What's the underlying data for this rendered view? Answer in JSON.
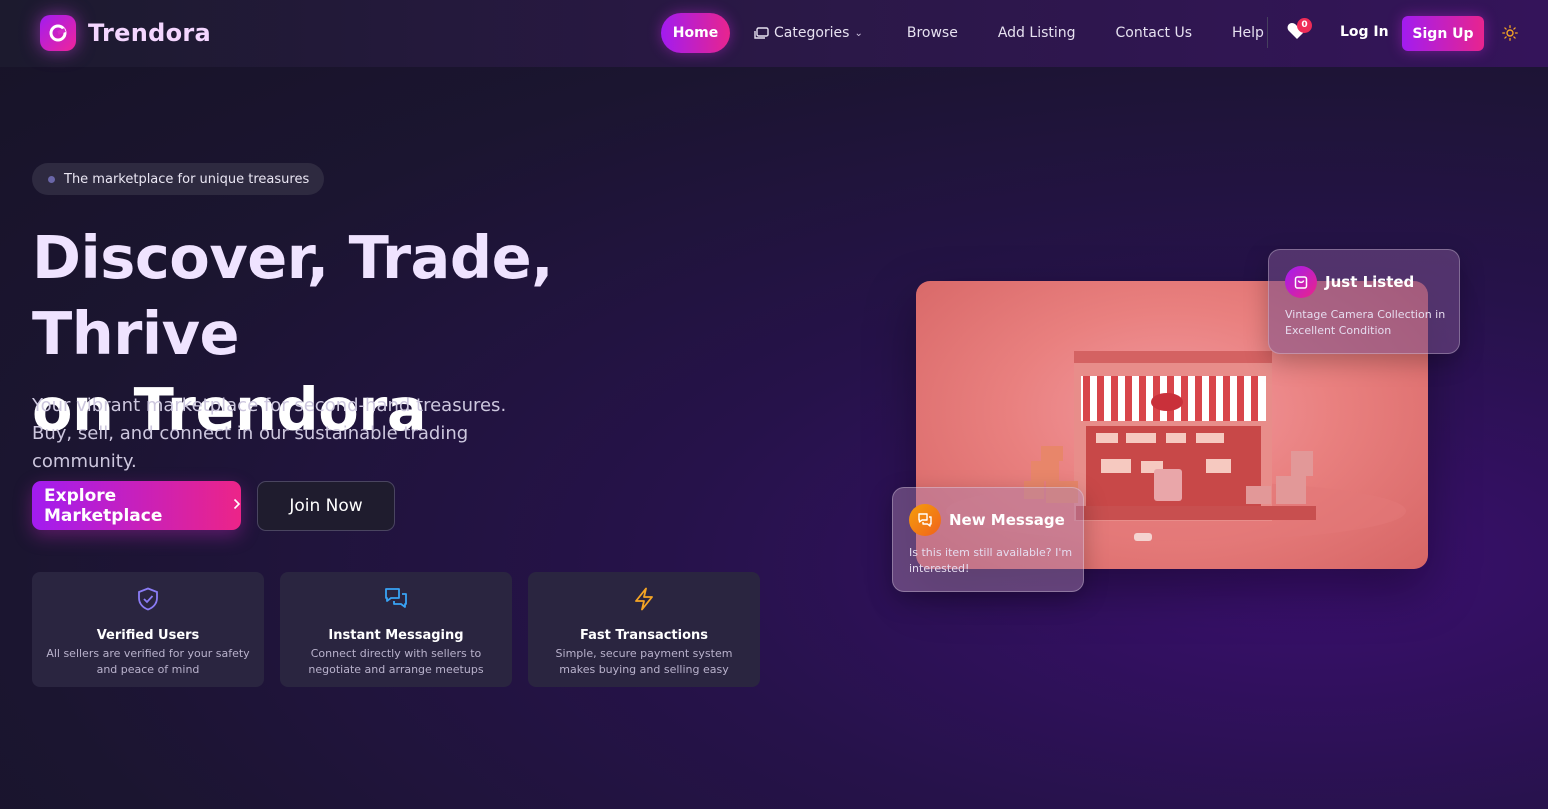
{
  "brand": {
    "name": "Trendora",
    "accent_start": "#a21cf0",
    "accent_end": "#e8248e"
  },
  "nav": {
    "items": [
      {
        "label": "Home",
        "active": true
      },
      {
        "label": "Categories",
        "icon": "categories-icon",
        "dropdown": true
      },
      {
        "label": "Browse"
      },
      {
        "label": "Add Listing"
      },
      {
        "label": "Contact Us"
      },
      {
        "label": "Help"
      }
    ],
    "wishlist_count": "0",
    "login_label": "Log In",
    "signup_label": "Sign Up",
    "theme_toggle_icon": "sun-icon"
  },
  "hero": {
    "pill_text": "The marketplace for unique treasures",
    "headline_line1": "Discover, Trade, Thrive",
    "headline_line2": "on Trendora",
    "subtitle": "Your vibrant marketplace for second-hand treasures. Buy, sell, and connect in our sustainable trading community.",
    "primary_cta": "Explore Marketplace",
    "secondary_cta": "Join Now"
  },
  "features": [
    {
      "icon": "shield-check-icon",
      "title": "Verified Users",
      "description": "All sellers are verified for your safety and peace of mind",
      "color": "#8b7cf6"
    },
    {
      "icon": "chat-icon",
      "title": "Instant Messaging",
      "description": "Connect directly with sellers to negotiate and arrange meetups",
      "color": "#38a3f5"
    },
    {
      "icon": "lightning-icon",
      "title": "Fast Transactions",
      "description": "Simple, secure payment system makes buying and selling easy",
      "color": "#f5a524"
    }
  ],
  "cards": {
    "just_listed": {
      "title": "Just Listed",
      "text": "Vintage Camera Collection in Excellent Condition",
      "icon": "bag-icon"
    },
    "new_message": {
      "title": "New Message",
      "text": "Is this item still available? I'm interested!",
      "icon": "chat-icon"
    }
  }
}
